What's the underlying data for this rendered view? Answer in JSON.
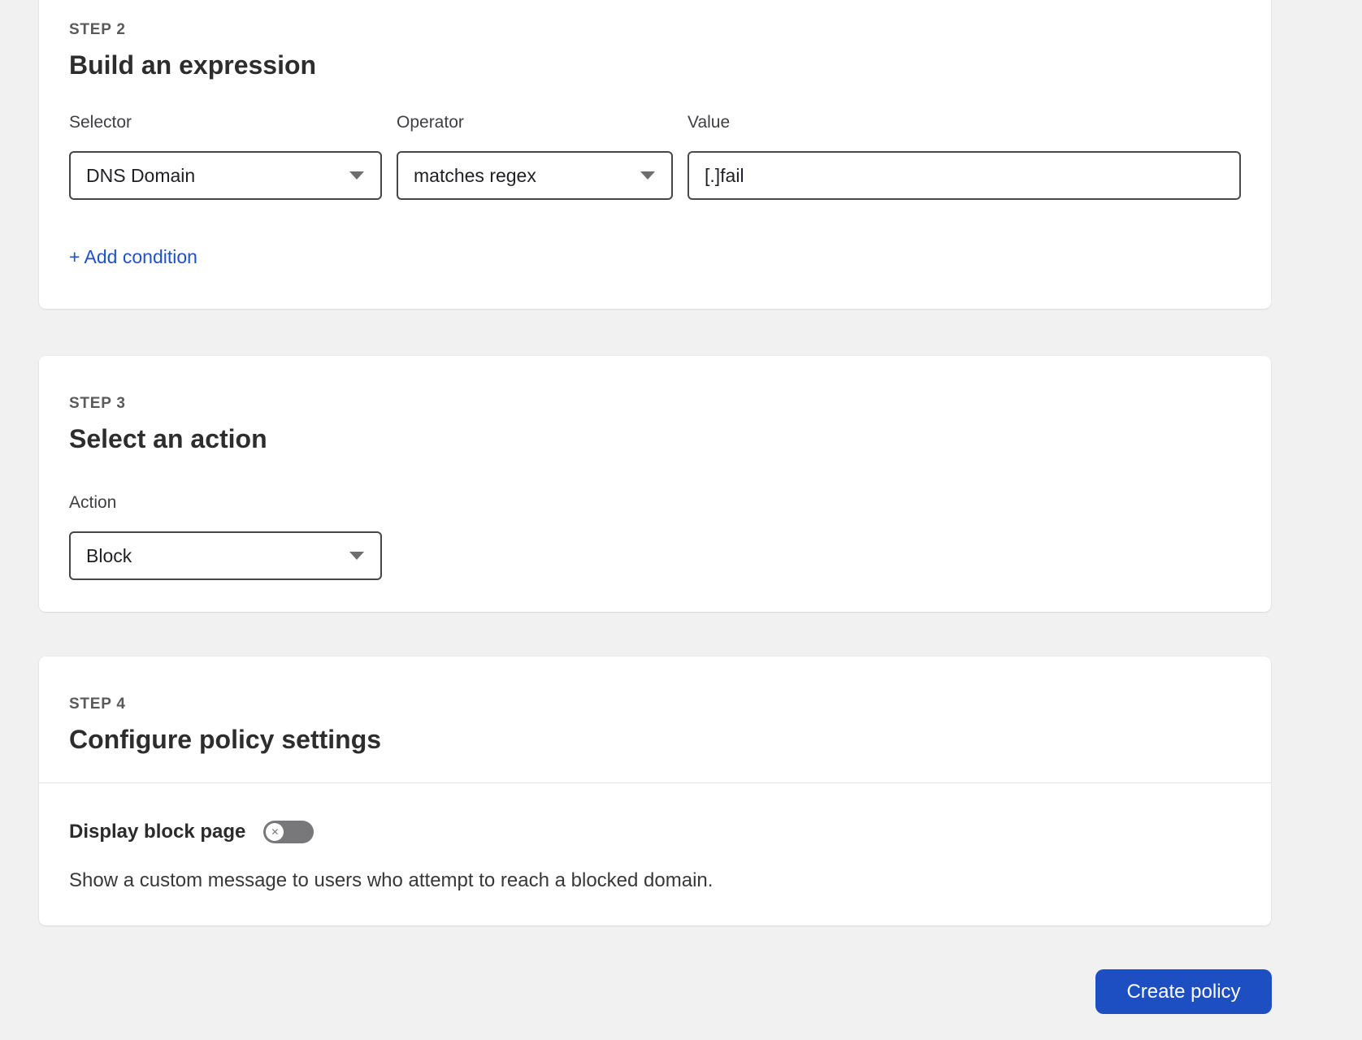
{
  "colors": {
    "page_background": "#f1f1f1",
    "card_background": "#ffffff",
    "accent_blue": "#1d4fc3",
    "link_blue": "#2151c8",
    "input_border": "#464646",
    "toggle_off_gray": "#78787a"
  },
  "icons": {
    "dropdown_caret": "caret-down-icon",
    "toggle_knob": "x-circle-icon"
  },
  "step2": {
    "step_label": "STEP 2",
    "title": "Build an expression",
    "selector": {
      "label": "Selector",
      "value": "DNS Domain"
    },
    "operator": {
      "label": "Operator",
      "value": "matches regex"
    },
    "value_field": {
      "label": "Value",
      "value": "[.]fail"
    },
    "add_condition_link": "+ Add condition"
  },
  "step3": {
    "step_label": "STEP 3",
    "title": "Select an action",
    "action": {
      "label": "Action",
      "value": "Block"
    }
  },
  "step4": {
    "step_label": "STEP 4",
    "title": "Configure policy settings",
    "block_page_toggle": {
      "label": "Display block page",
      "state": "off",
      "knob_glyph": "✕"
    },
    "description": "Show a custom message to users who attempt to reach a blocked domain."
  },
  "footer": {
    "create_policy_button": "Create policy"
  }
}
